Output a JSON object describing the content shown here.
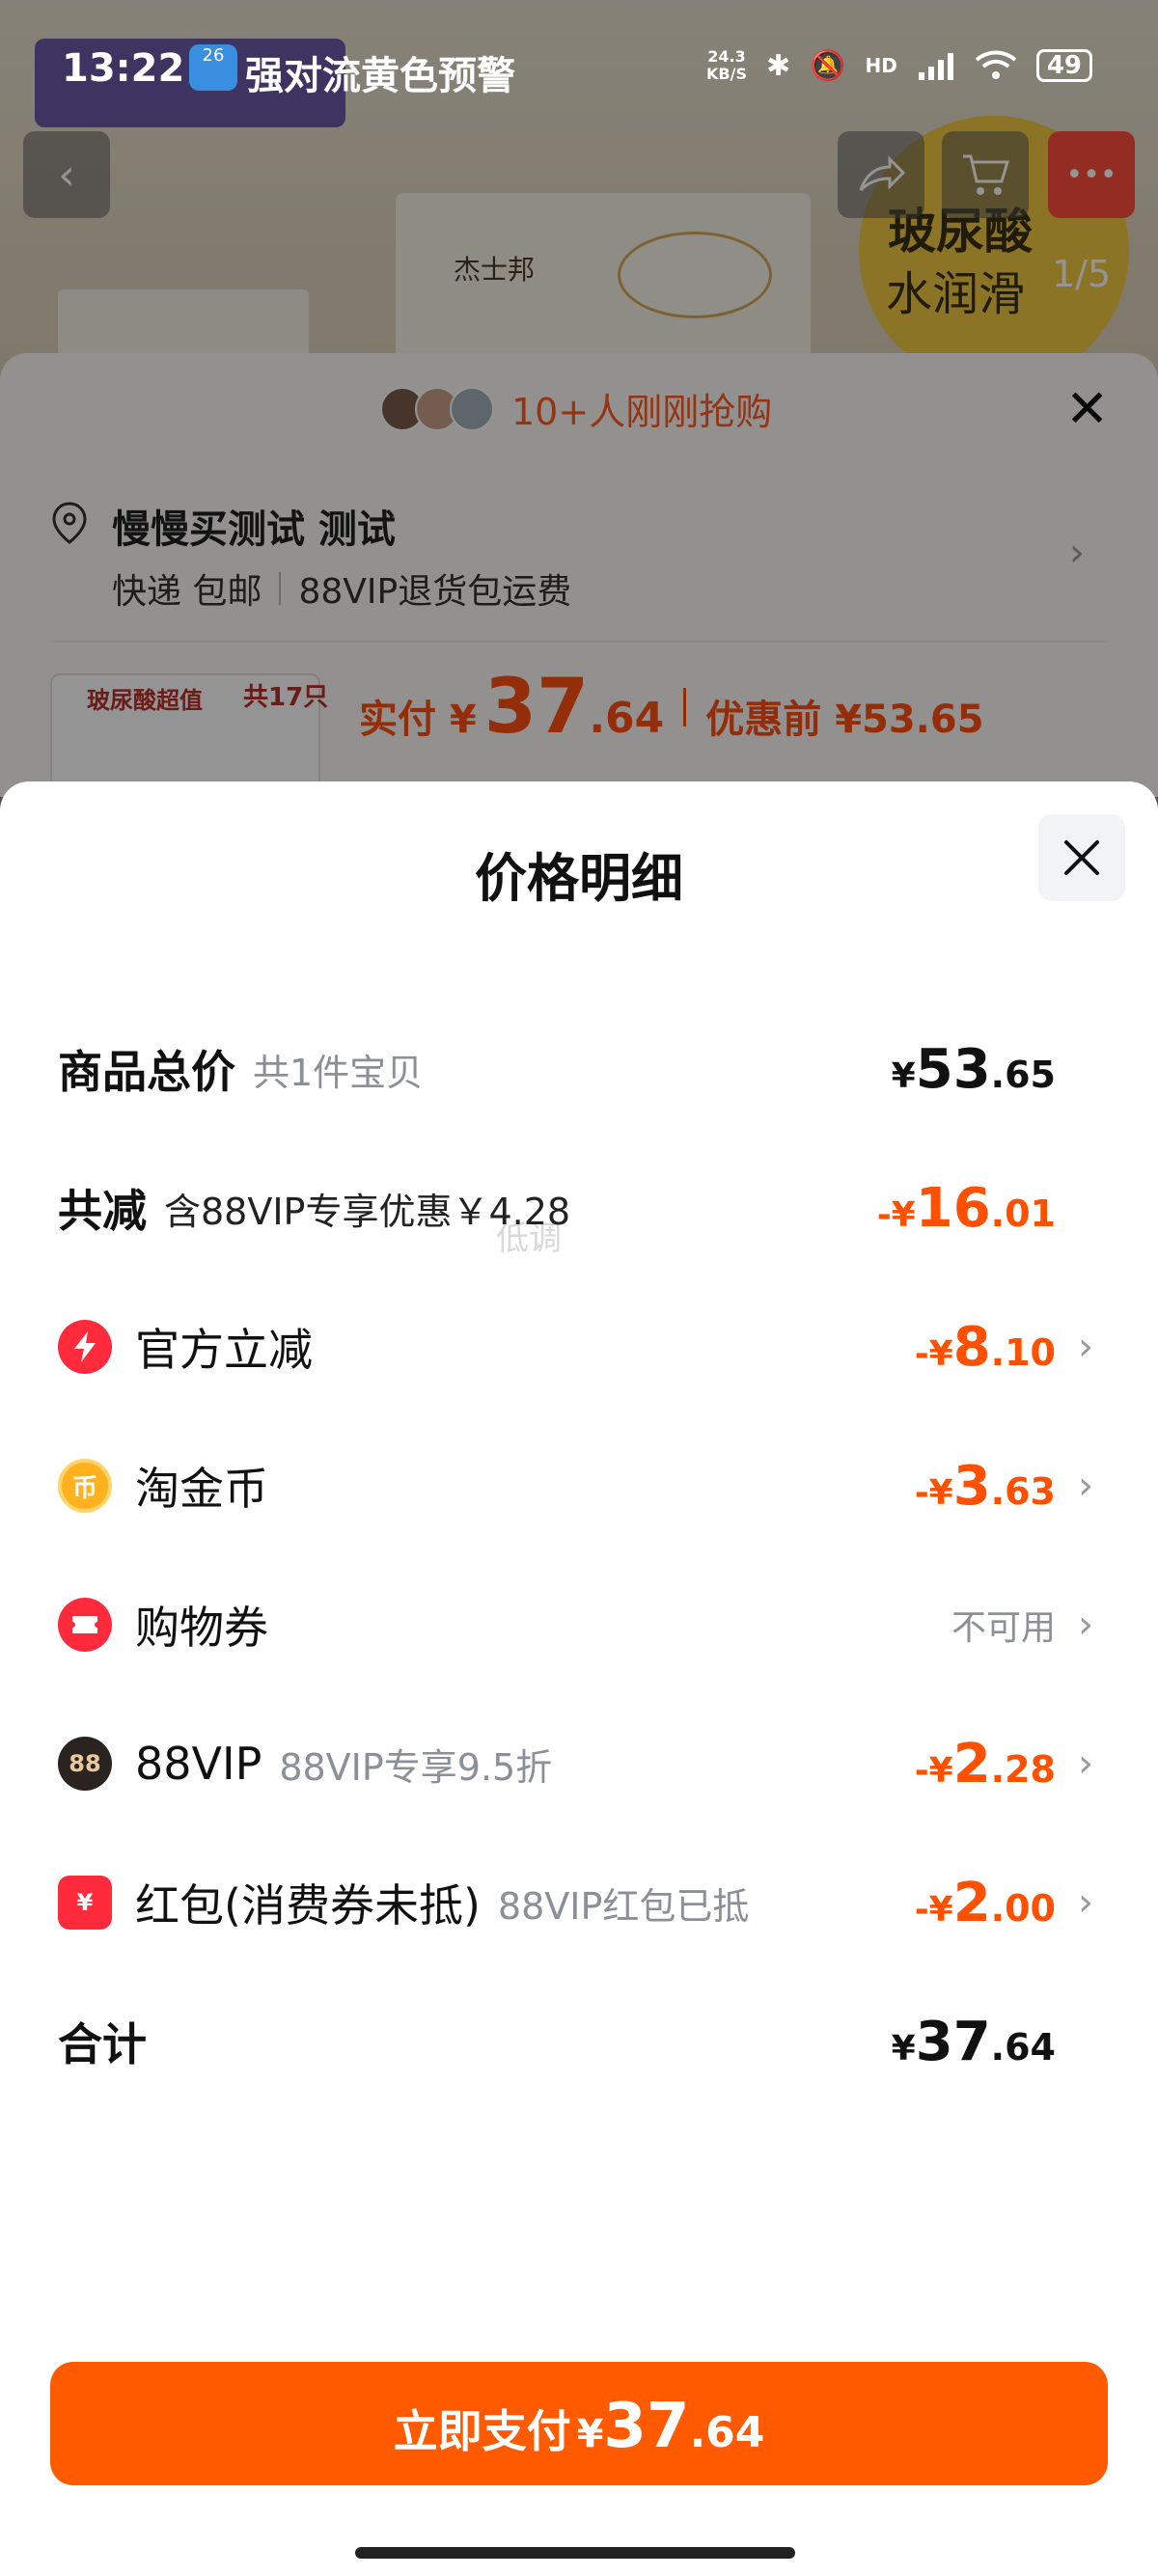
{
  "status_bar": {
    "time": "13:22",
    "weather_badge": "26",
    "alert": "强对流黄色预警",
    "net_speed_value": "24.3",
    "net_speed_unit": "KB/S",
    "signal": "HD",
    "battery": "49"
  },
  "background": {
    "brand": "杰士邦",
    "seal_title": "玻尿酸",
    "seal_subtitle": "水润滑",
    "image_counter": "1/5",
    "back_icon": "chevron-left-icon",
    "share_icon": "share-icon",
    "cart_icon": "cart-icon"
  },
  "purchase_panel": {
    "buyers_text": "10+人刚刚抢购",
    "address_name": "慢慢买测试 测试",
    "shipping": "快递 包邮",
    "return_policy": "88VIP退货包运费",
    "thumb_tag": "玻尿酸超值",
    "thumb_count": "共17只",
    "pay_label": "实付 ¥",
    "pay_int": "37",
    "pay_dec": ".64",
    "before_label": "优惠前 ¥53.65"
  },
  "price_detail": {
    "title": "价格明细",
    "watermark": "低调",
    "rows": [
      {
        "title": "商品总价",
        "note": "共1件宝贝",
        "cur": "¥",
        "int": "53",
        "dec": ".65"
      },
      {
        "title": "共减",
        "note": "含88VIP专享优惠￥4.28",
        "cur": "-¥",
        "int": "16",
        "dec": ".01"
      },
      {
        "title": "官方立减",
        "icon": "lightning-icon",
        "cur": "-¥",
        "int": "8",
        "dec": ".10"
      },
      {
        "title": "淘金币",
        "icon": "coin-icon",
        "icon_text": "币",
        "cur": "-¥",
        "int": "3",
        "dec": ".63"
      },
      {
        "title": "购物券",
        "icon": "ticket-icon",
        "status": "不可用"
      },
      {
        "title": "88VIP",
        "icon": "vip-icon",
        "icon_text": "88",
        "note": "88VIP专享9.5折",
        "cur": "-¥",
        "int": "2",
        "dec": ".28"
      },
      {
        "title": "红包(消费券未抵)",
        "icon": "red-packet-icon",
        "icon_text": "¥",
        "note": "88VIP红包已抵",
        "cur": "-¥",
        "int": "2",
        "dec": ".00"
      },
      {
        "title": "合计",
        "cur": "¥",
        "int": "37",
        "dec": ".64"
      }
    ],
    "pay_button": {
      "label": "立即支付",
      "cur": "¥",
      "int": "37",
      "dec": ".64"
    }
  },
  "colors": {
    "accent": "#ff5a00",
    "price_orange": "#ff5000",
    "muted": "#8a8f99"
  }
}
